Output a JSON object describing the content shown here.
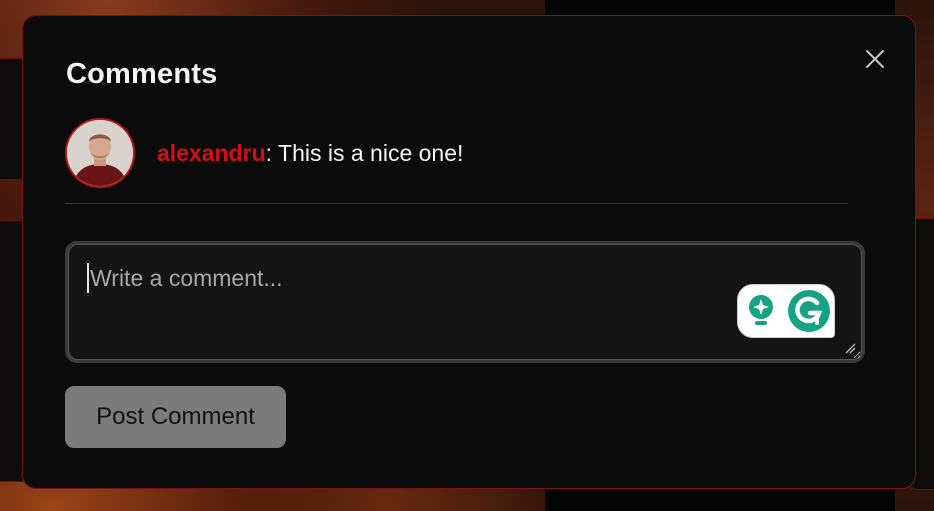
{
  "modal": {
    "title": "Comments",
    "close_icon": "close-icon"
  },
  "comments": [
    {
      "author": "alexandru",
      "separator": ":",
      "text": " This is a nice one!"
    }
  ],
  "input": {
    "placeholder": "Write a comment...",
    "value": ""
  },
  "grammarly": {
    "icons": [
      "grammarly-bulb-icon",
      "grammarly-logo-icon"
    ],
    "accent": "#15a383"
  },
  "actions": {
    "post_label": "Post Comment"
  },
  "colors": {
    "accent": "#d10f14",
    "border": "#7c1414",
    "background": "#0b0b0c",
    "button": "#7b7b7b"
  }
}
